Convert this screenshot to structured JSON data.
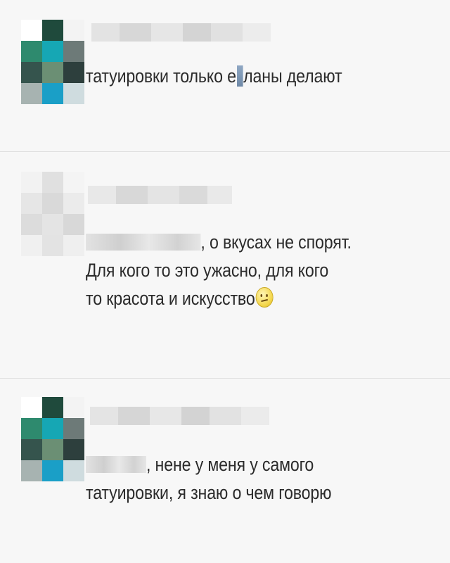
{
  "comments": [
    {
      "text": "татуировки только е",
      "text_after_censor": "ланы делают"
    },
    {
      "line1": ", о вкусах не спорят.",
      "line2": "Для кого то это ужасно,  для кого",
      "line3": "то красота и искусство",
      "emoji": "confused-face"
    },
    {
      "line1": ", нене у меня у самого",
      "line2": "татуировки, я знаю о чем говорю"
    }
  ],
  "colors": {
    "background": "#f7f7f7",
    "text": "#2b2b2b",
    "divider": "#dedede",
    "censor": "#7f99b8",
    "emoji": "#f3d64a"
  }
}
